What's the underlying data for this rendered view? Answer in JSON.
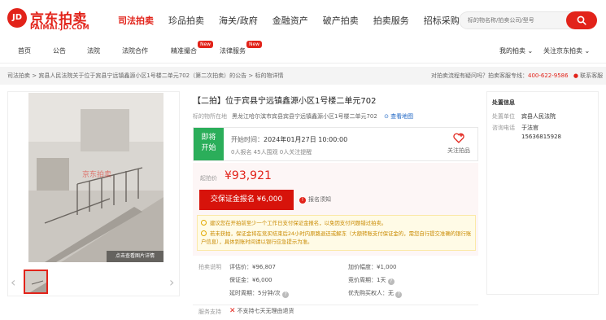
{
  "brand": {
    "mark": "JD",
    "cn": "京东拍卖",
    "en": "PAIMAI.JD.COM",
    "color": "#e2231a"
  },
  "main_nav": [
    {
      "label": "司法拍卖",
      "active": true
    },
    {
      "label": "珍品拍卖",
      "active": false
    },
    {
      "label": "海关/政府",
      "active": false
    },
    {
      "label": "金融资产",
      "active": false
    },
    {
      "label": "破产拍卖",
      "active": false
    },
    {
      "label": "拍卖服务",
      "active": false
    },
    {
      "label": "招标采购",
      "active": false
    }
  ],
  "search": {
    "placeholder": "标的物名称/拍卖公司/型号"
  },
  "sub_nav": {
    "home": "首页",
    "notice": "公告",
    "court": "法院",
    "cooperation": "法院合作",
    "matchmaking": "精准撮合",
    "legal": "法律服务",
    "new_badge": "New",
    "my_auction": "我的拍卖",
    "follow_jd": "关注京东拍卖"
  },
  "breadcrumb": "司法拍卖 > 宾县人民法院关于位于宾县宁远镇鑫源小区1号楼二单元702（第二次拍卖）的公告 > 标的物详情",
  "help": {
    "text": "对拍卖流程有疑问吗？拍卖客服专线：",
    "phone": "400-622-9586",
    "contact": "联系客服"
  },
  "gallery": {
    "caption": "点击查看图片详情"
  },
  "item": {
    "title": "【二拍】位于宾县宁远镇鑫源小区1号楼二单元702",
    "location_label": "标的物所在地",
    "location": "黑龙江哈尔滨市宾县宾县宁远镇鑫源小区1号楼二单元702",
    "map_link": "查看地图"
  },
  "status": {
    "tag_line1": "即将",
    "tag_line2": "开始",
    "start_label": "开始时间：",
    "start_time": "2024年01月27日 10:00:00",
    "stats": "0人报名   45人围观   0人关注提醒",
    "follow_label": "关注拍品"
  },
  "price": {
    "start_label": "起拍价",
    "start_value": "¥93,921",
    "deposit_button": "交保证金报名 ¥6,000",
    "notice_link": "报名须知"
  },
  "tips": [
    "建议您在开拍前至少一个工作日支付保证金报名，以免因支付问题错过拍卖。",
    "若未获拍，保证金将在竞买结束后24小时内原路退还或解冻（大额转账支付保证金的，需您自行提交准确的银行账户信息），具体到账时间请以银行应急提示为准。"
  ],
  "details": {
    "section_label": "拍卖说明",
    "rows": [
      {
        "left_label": "评估价：",
        "left_value": "¥96,807",
        "right_label": "加价幅度：",
        "right_value": "¥1,000"
      },
      {
        "left_label": "保证金：",
        "left_value": "¥6,000",
        "right_label": "竞价周期：",
        "right_value": "1天"
      },
      {
        "left_label": "延时周期：",
        "left_value": "5分钟/次",
        "right_label": "优先购买权人：",
        "right_value": "无"
      }
    ],
    "service_label": "服务支持",
    "service_value": "不支持七天无理由退货"
  },
  "org": {
    "heading": "处置信息",
    "unit_label": "处置单位",
    "unit": "宾县人民法院",
    "contact_label": "咨询电话",
    "contact_name": "于法官",
    "phone": "15636815928"
  }
}
